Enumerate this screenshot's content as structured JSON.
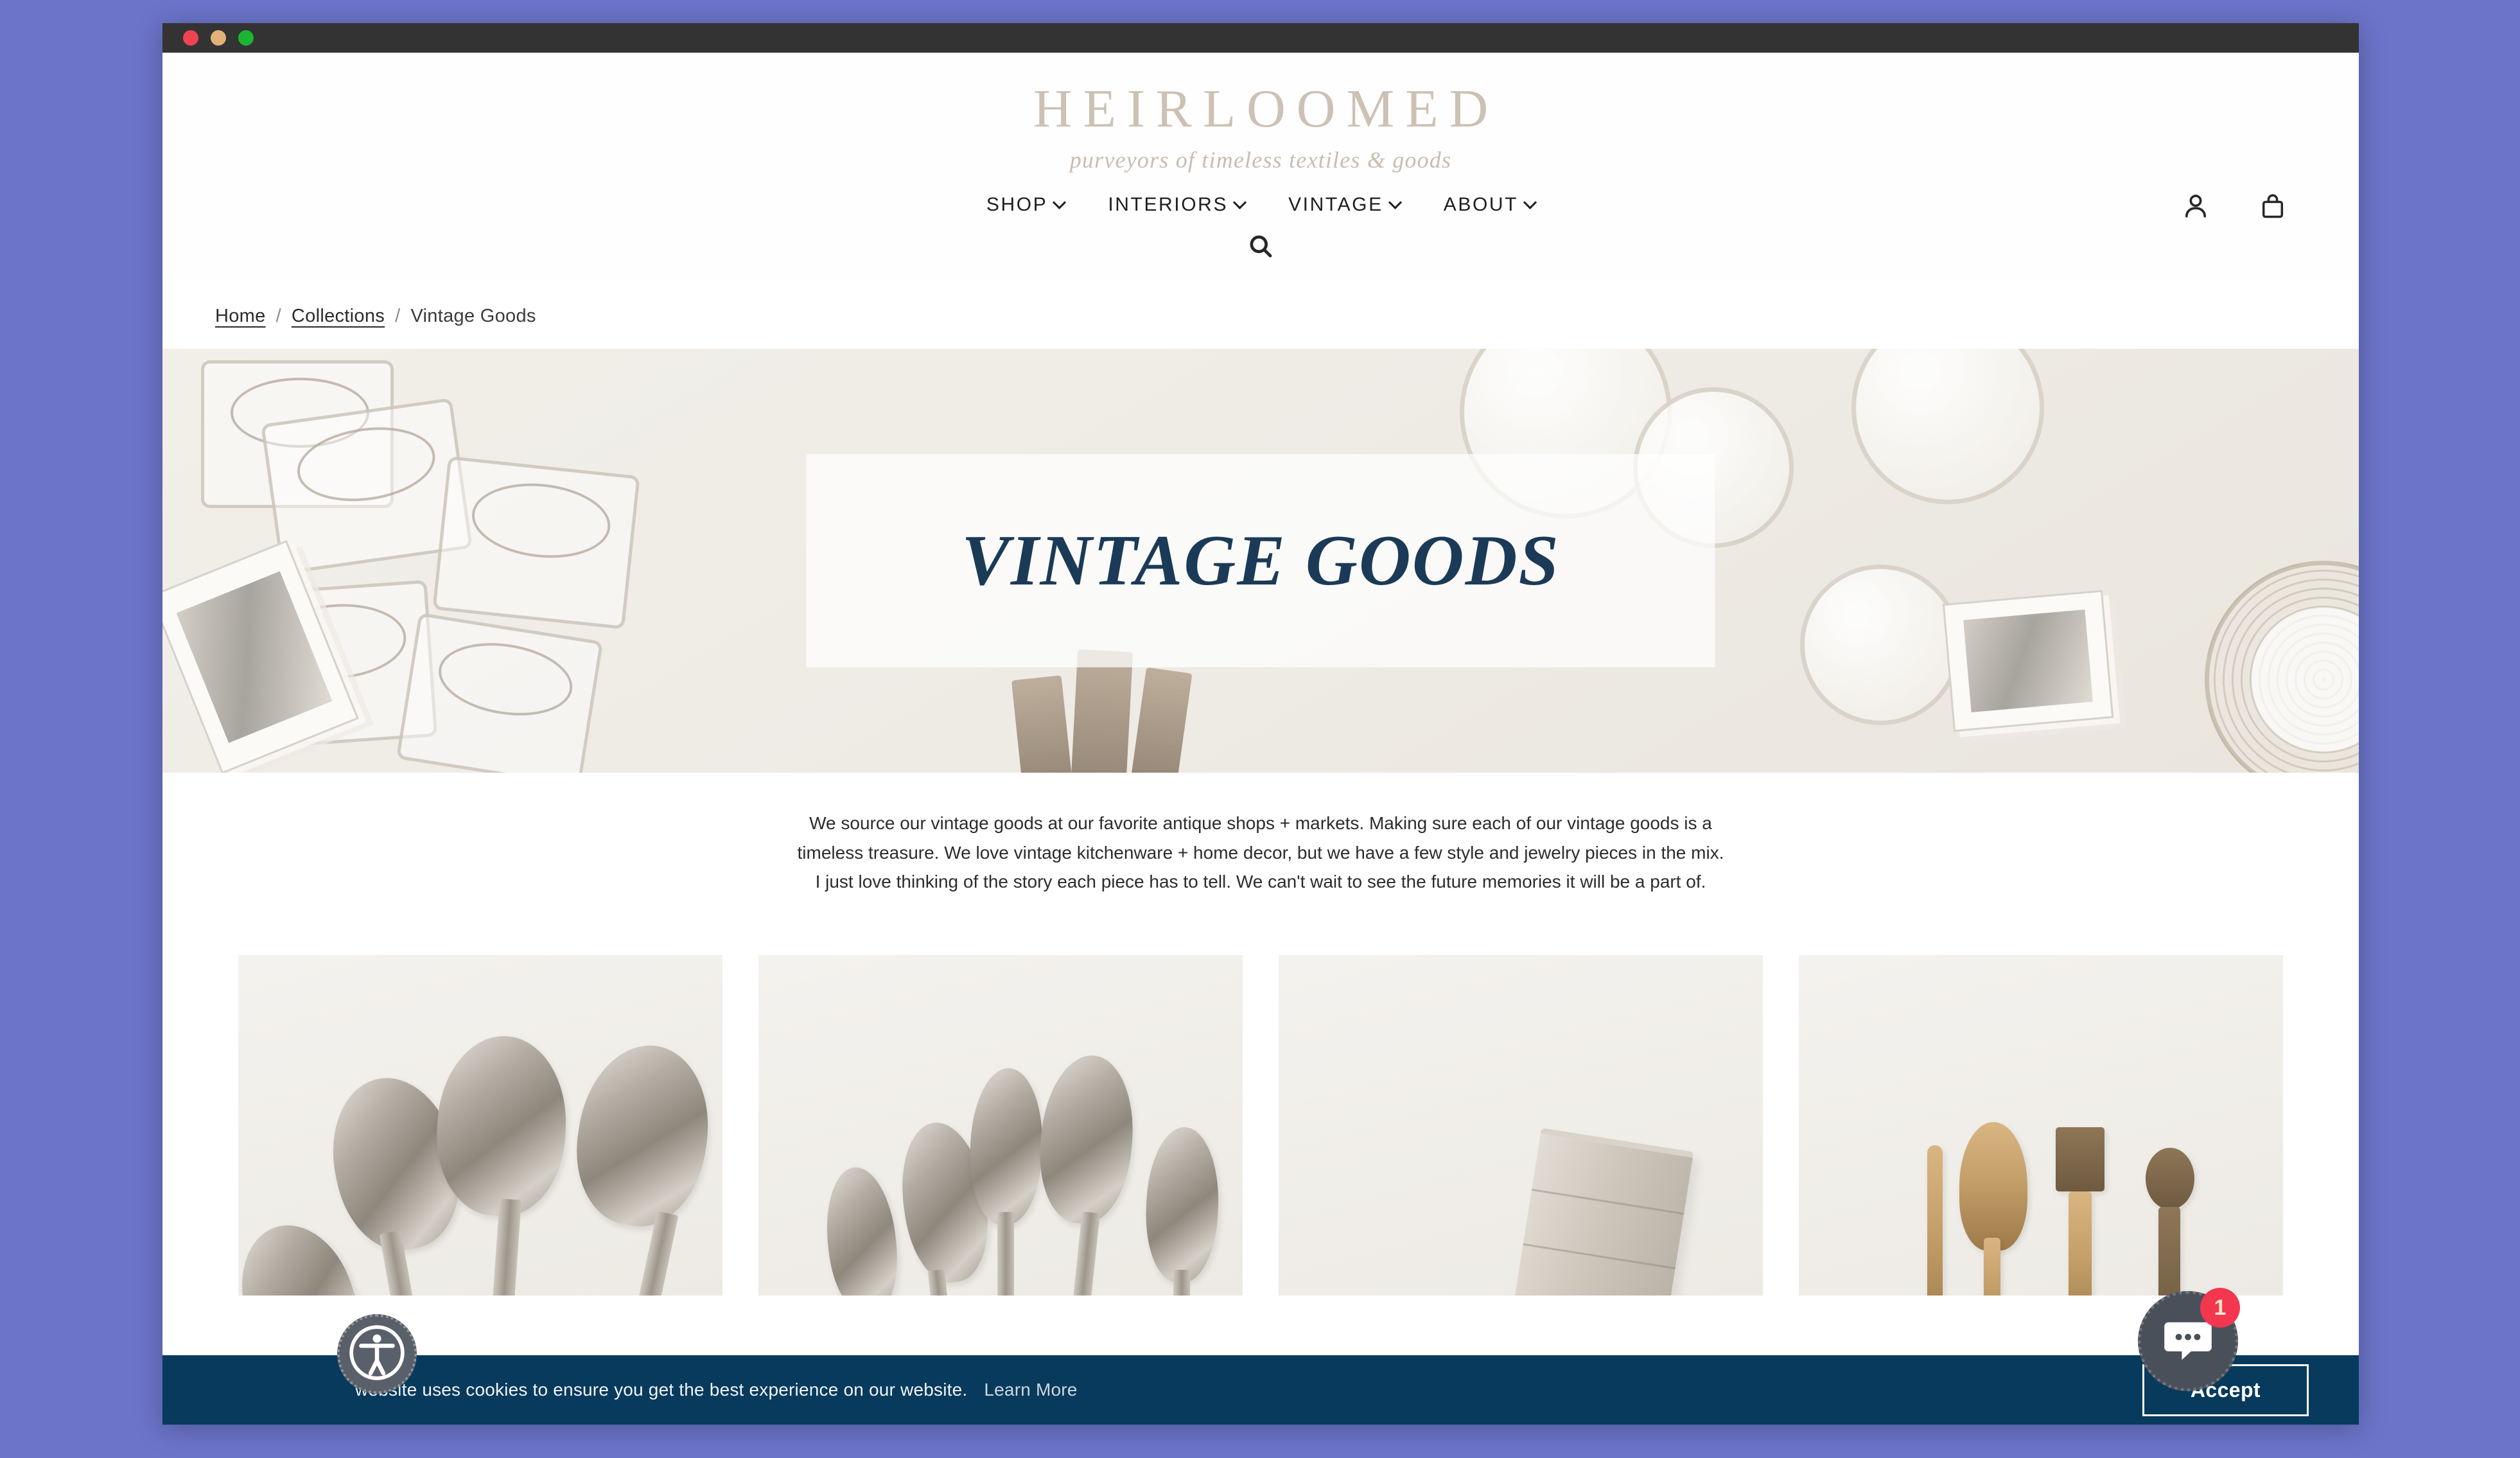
{
  "window": {
    "traffic_lights": [
      "close",
      "minimize",
      "maximize"
    ],
    "colors": {
      "close": "#f04352",
      "minimize": "#e2b179",
      "maximize": "#1bb534",
      "titlebar": "#333333"
    }
  },
  "header": {
    "brand_name": "HEIRLOOMED",
    "brand_tagline": "purveyors of timeless textiles & goods",
    "brand_color": "#cdc1b4",
    "nav": [
      {
        "label": "SHOP",
        "has_dropdown": true
      },
      {
        "label": "INTERIORS",
        "has_dropdown": true
      },
      {
        "label": "VINTAGE",
        "has_dropdown": true
      },
      {
        "label": "ABOUT",
        "has_dropdown": true
      }
    ],
    "actions": [
      {
        "icon": "search-icon",
        "label": "Search"
      },
      {
        "icon": "account-icon",
        "label": "Account"
      },
      {
        "icon": "cart-icon",
        "label": "Cart"
      }
    ]
  },
  "breadcrumb": {
    "items": [
      {
        "label": "Home",
        "is_link": true
      },
      {
        "label": "Collections",
        "is_link": true
      },
      {
        "label": "Vintage Goods",
        "is_link": false
      }
    ],
    "separator": "/"
  },
  "hero": {
    "title": "VINTAGE GOODS",
    "title_color": "#1b3a57",
    "panel_background": "rgba(255,255,255,0.72)",
    "image_description": "flat-lay of vintage glass jars, ironstone plates, blue willow china and old photographs"
  },
  "intro": {
    "paragraph": "We source our vintage goods at our favorite antique shops + markets. Making sure each of our vintage goods is a timeless treasure. We love vintage kitchenware + home decor, but we have a few style and jewelry pieces in the mix. I just love thinking of the story each piece has to tell. We can't wait to see the future memories it will be a part of."
  },
  "products": [
    {
      "image_description": "three tarnished silver serving spoons"
    },
    {
      "image_description": "five vintage silver spoons fanned out"
    },
    {
      "image_description": "antique tin measuring cup"
    },
    {
      "image_description": "wooden kitchen utensils, rolling tool and scoop"
    }
  ],
  "cookie_banner": {
    "message": "website uses cookies to ensure you get the best experience on our website.",
    "learn_more_label": "Learn More",
    "accept_label": "Accept",
    "background_color": "#073a5c"
  },
  "accessibility_widget": {
    "icon": "accessibility-icon",
    "label": "Accessibility options"
  },
  "chat_widget": {
    "icon": "chat-bubble-icon",
    "badge_count": "1",
    "badge_color": "#f2374f"
  }
}
